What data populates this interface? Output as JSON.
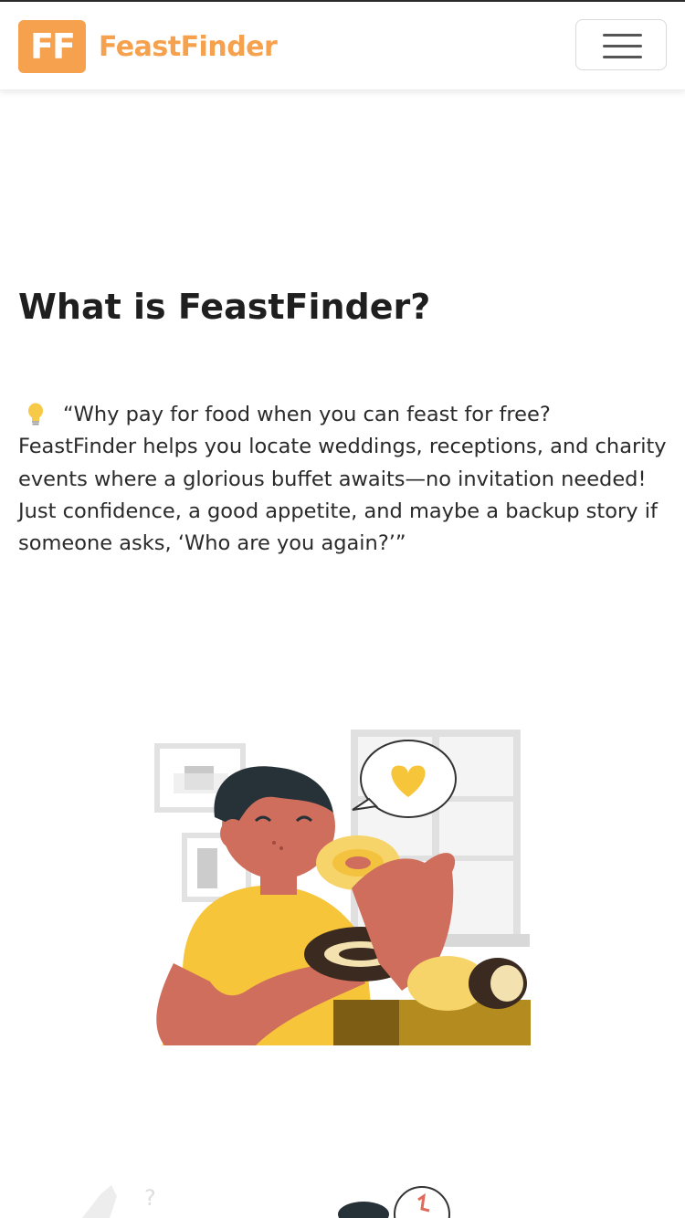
{
  "brand": {
    "mark_text": "FF",
    "name": "FeastFinder",
    "color": "#f6a14d"
  },
  "nav": {
    "toggle_icon": "hamburger-menu-icon"
  },
  "main": {
    "heading": "What is FeastFinder?",
    "intro_icon": "lightbulb-icon",
    "description": "“Why pay for food when you can feast for free? FeastFinder helps you locate weddings, receptions, and charity events where a glorious buffet awaits—no invitation needed! Just confidence, a good appetite, and maybe a backup story if someone asks, ‘Who are you again?’”"
  },
  "illustrations": {
    "primary": "person-eating-donuts-illustration",
    "secondary": "partial-illustration"
  }
}
